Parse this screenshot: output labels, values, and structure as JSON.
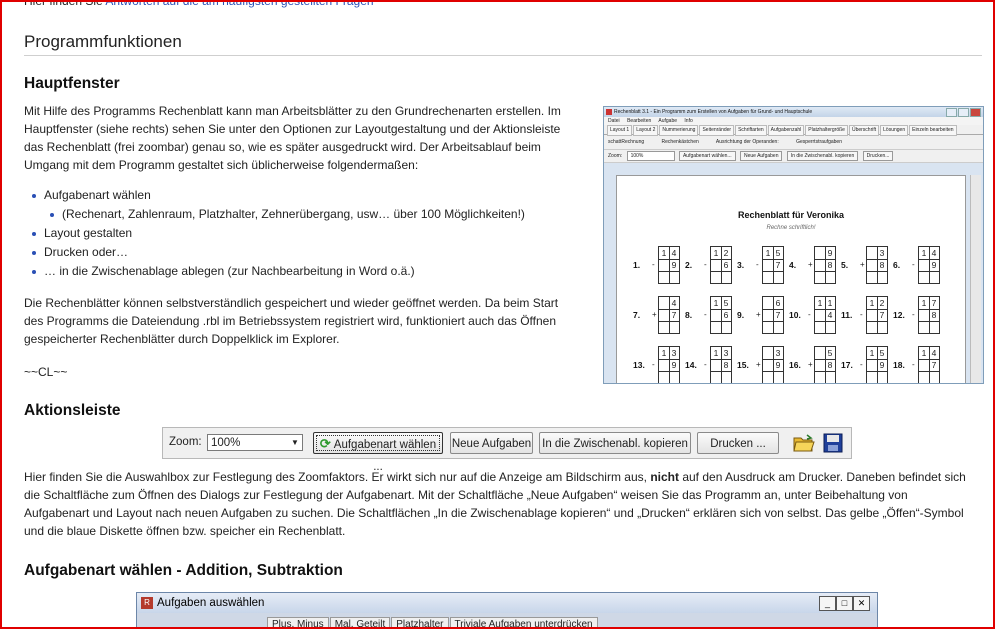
{
  "top_text": {
    "prefix": "Hier finden Sie",
    "link": "Antworten auf die am häufigsten gestellten Fragen"
  },
  "sections": {
    "programmfunktionen": "Programmfunktionen",
    "hauptfenster": "Hauptfenster",
    "aktionsleiste": "Aktionsleiste",
    "aufgabenart": "Aufgabenart wählen - Addition, Subtraktion"
  },
  "hauptfenster": {
    "para1_lines": [
      "Mit Hilfe des Programms Rechenblatt kann man Arbeitsblätter zu den Grundrechenarten erstellen. Im",
      "Hauptfenster (siehe rechts) sehen Sie unter den Optionen zur Layoutgestaltung und der Aktionsleiste",
      "das Rechenblatt (frei zoombar) genau so, wie es später ausgedruckt wird. Der Arbeitsablauf beim",
      "Umgang mit dem Programm gestaltet sich üblicherweise folgendermaßen:"
    ],
    "bullets": [
      "Aufgabenart wählen",
      "(Rechenart, Zahlenraum, Platzhalter, Zehnerübergang, usw… über 100 Möglichkeiten!)",
      "Layout gestalten",
      "Drucken oder…",
      "… in die Zwischenablage ablegen (zur Nachbearbeitung in Word o.ä.)"
    ],
    "para2_lines": [
      "Die Rechenblätter können selbstverständlich gespeichert und wieder geöffnet werden. Da beim Start",
      "des Programms die Dateiendung .rbl im Betriebssystem registriert wird, funktioniert auch das Öffnen",
      "gespeicherter Rechenblätter durch Doppelklick im Explorer."
    ],
    "signature": "~~CL~~"
  },
  "screenshot": {
    "title": "Rechenblatt 3.1 - Ein Programm zum Erstellen von Aufgaben für Grund- und Hauptschule",
    "menu": [
      "Datei",
      "Bearbeiten",
      "Aufgabe",
      "Info"
    ],
    "tabs": [
      "Layout 1",
      "Layout 2",
      "Nummerierung",
      "Seitenränder",
      "Schriftarten",
      "Aufgabenzahl",
      "Platzhaltergröße",
      "Überschrift",
      "Lösungen",
      "Einzeln bearbeiten"
    ],
    "options": [
      "schattRechnung",
      "Rechenkästchen",
      "Ausrichtung der Operanden:",
      "Gesperrtstraufgaben"
    ],
    "toolbar": [
      "Zoom:",
      "100%",
      "Aufgabenart wählen...",
      "Neue Aufgaben",
      "In die Zwischenabl. kopieren",
      "Drucken..."
    ],
    "sheet_title": "Rechenblatt für Veronika",
    "sheet_subtitle": "Rechne schriftlich!",
    "problems": [
      {
        "n": "1.",
        "op": "-",
        "t": [
          "1",
          "4"
        ],
        "b": [
          "",
          "9"
        ]
      },
      {
        "n": "2.",
        "op": "-",
        "t": [
          "1",
          "2"
        ],
        "b": [
          "",
          "6"
        ]
      },
      {
        "n": "3.",
        "op": "-",
        "t": [
          "1",
          "5"
        ],
        "b": [
          "",
          "7"
        ]
      },
      {
        "n": "4.",
        "op": "+",
        "t": [
          "",
          "9"
        ],
        "b": [
          "",
          "8"
        ]
      },
      {
        "n": "5.",
        "op": "+",
        "t": [
          "",
          "3"
        ],
        "b": [
          "",
          "8"
        ]
      },
      {
        "n": "6.",
        "op": "-",
        "t": [
          "1",
          "4"
        ],
        "b": [
          "",
          "9"
        ]
      },
      {
        "n": "7.",
        "op": "+",
        "t": [
          "",
          "4"
        ],
        "b": [
          "",
          "7"
        ]
      },
      {
        "n": "8.",
        "op": "-",
        "t": [
          "1",
          "5"
        ],
        "b": [
          "",
          "6"
        ]
      },
      {
        "n": "9.",
        "op": "+",
        "t": [
          "",
          "6"
        ],
        "b": [
          "",
          "7"
        ]
      },
      {
        "n": "10.",
        "op": "-",
        "t": [
          "1",
          "1"
        ],
        "b": [
          "",
          "4"
        ]
      },
      {
        "n": "11.",
        "op": "-",
        "t": [
          "1",
          "2"
        ],
        "b": [
          "",
          "7"
        ]
      },
      {
        "n": "12.",
        "op": "-",
        "t": [
          "1",
          "7"
        ],
        "b": [
          "",
          "8"
        ]
      },
      {
        "n": "13.",
        "op": "-",
        "t": [
          "1",
          "3"
        ],
        "b": [
          "",
          "9"
        ]
      },
      {
        "n": "14.",
        "op": "-",
        "t": [
          "1",
          "3"
        ],
        "b": [
          "",
          "8"
        ]
      },
      {
        "n": "15.",
        "op": "+",
        "t": [
          "",
          "3"
        ],
        "b": [
          "",
          "9"
        ]
      },
      {
        "n": "16.",
        "op": "+",
        "t": [
          "",
          "5"
        ],
        "b": [
          "",
          "8"
        ]
      },
      {
        "n": "17.",
        "op": "-",
        "t": [
          "1",
          "5"
        ],
        "b": [
          "",
          "9"
        ]
      },
      {
        "n": "18.",
        "op": "-",
        "t": [
          "1",
          "4"
        ],
        "b": [
          "",
          "7"
        ]
      }
    ]
  },
  "aktionsleiste": {
    "zoom_label": "Zoom:",
    "zoom_value": "100%",
    "buttons": {
      "aufgabenart": "Aufgabenart wählen ...",
      "neue": "Neue Aufgaben",
      "kopieren": "In die Zwischenabl. kopieren",
      "drucken": "Drucken ..."
    },
    "para_lines": [
      [
        "Hier finden Sie die Auswahlbox zur Festlegung des Zoomfaktors. Er wirkt sich nur auf die Anzeige am Bildschirm aus,",
        "nicht",
        "auf den Ausdruck am Drucker. Daneben befindet sich"
      ],
      "die Schaltfläche zum Öffnen des Dialogs zur Festlegung der Aufgabenart. Mit der Schaltfläche „Neue Aufgaben“ weisen Sie das Programm an, unter Beibehaltung von",
      "Aufgabenart und Layout nach neuen Aufgaben zu suchen. Die Schaltflächen „In die Zwischenablage kopieren“ und „Drucken“ erklären sich von selbst. Das gelbe „Öffen“-Symbol",
      "und die blaue Diskette öffnen bzw. speicher ein Rechenblatt."
    ]
  },
  "dialog": {
    "title": "Aufgaben auswählen",
    "tabs": [
      "Plus, Minus",
      "Mal, Geteilt",
      "Platzhalter",
      "Triviale Aufgaben unterdrücken"
    ]
  },
  "colors": {
    "frame": "#e00000",
    "link": "#2a4fb5",
    "window_blue": "#c8d6ea"
  }
}
